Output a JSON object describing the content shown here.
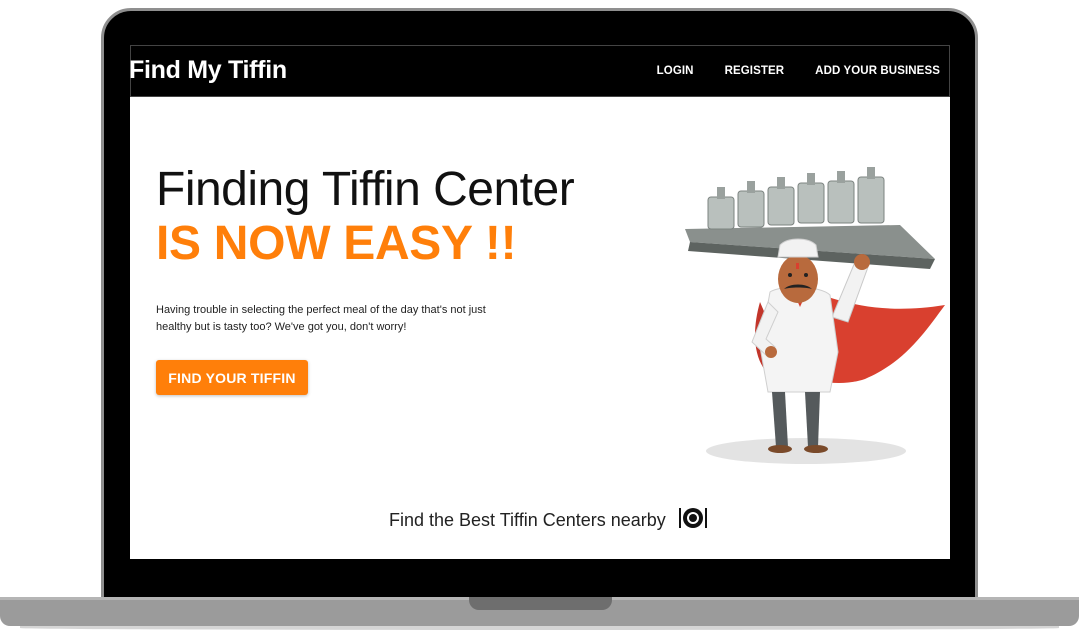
{
  "navbar": {
    "brand": "Find My Tiffin",
    "links": [
      "LOGIN",
      "REGISTER",
      "ADD YOUR BUSINESS"
    ]
  },
  "hero": {
    "headline": "Finding Tiffin Center",
    "headline_accent": "IS NOW EASY !!",
    "description": "Having trouble in selecting the perfect meal of the day that's not just healthy but is tasty too? We've got you, don't worry!",
    "cta_label": "FIND YOUR TIFFIN",
    "illustration_icon": "tiffin-delivery-man-illustration"
  },
  "footer": {
    "tagline": "Find the Best Tiffin Centers nearby",
    "icon": "plate-cutlery-icon"
  },
  "colors": {
    "accent": "#ff7f0a",
    "navbar_bg": "#000000",
    "cape": "#d9402f"
  }
}
